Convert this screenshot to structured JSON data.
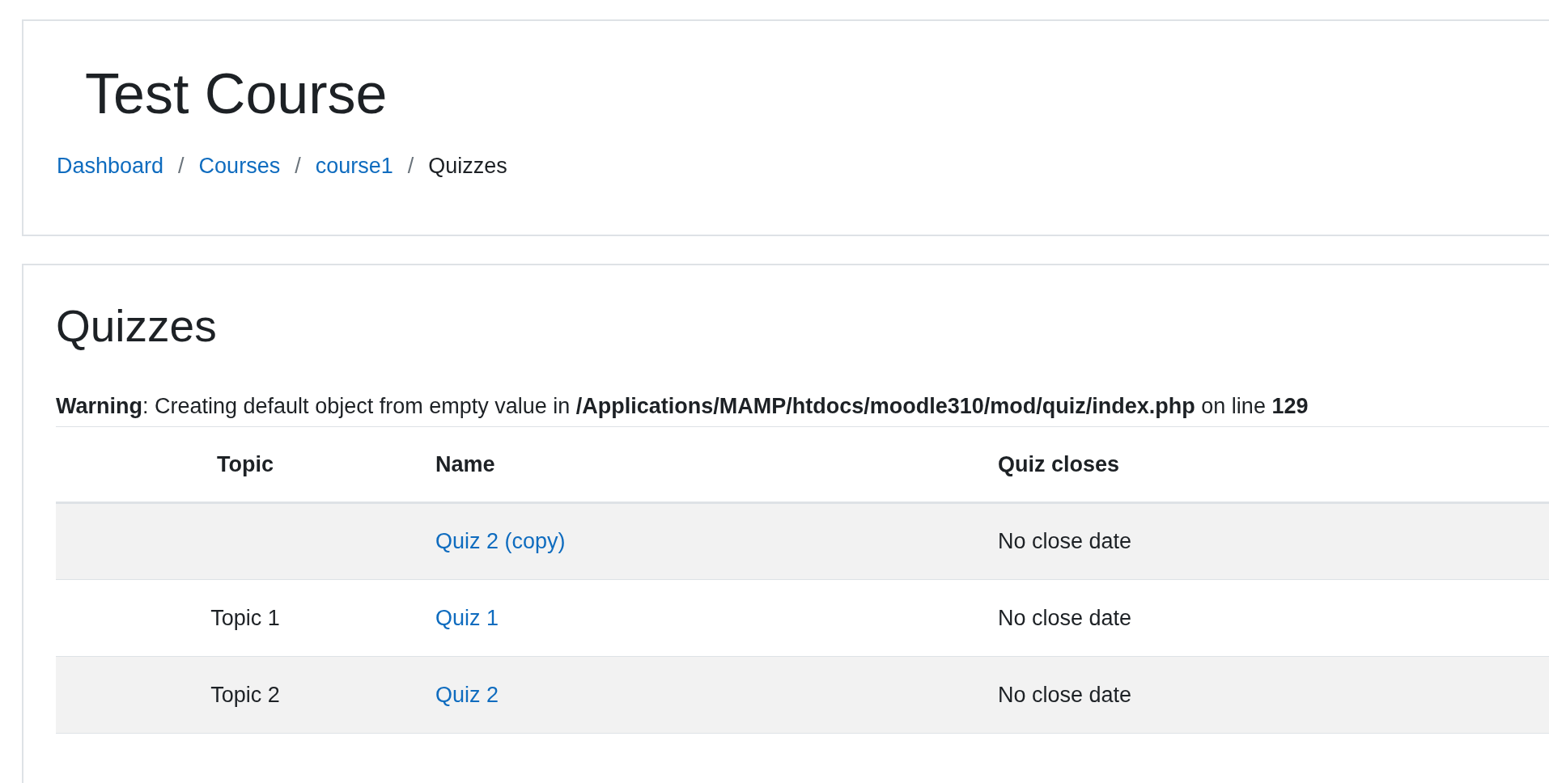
{
  "page_header": {
    "title": "Test Course",
    "separator": "/",
    "breadcrumb": [
      {
        "label": "Dashboard",
        "kind": "link"
      },
      {
        "label": "Courses",
        "kind": "link"
      },
      {
        "label": "course1",
        "kind": "link"
      },
      {
        "label": "Quizzes",
        "kind": "current"
      }
    ]
  },
  "main": {
    "heading": "Quizzes",
    "warning": "**Warning**: Creating default object from empty value in **/Applications/MAMP/htdocs/moodle310/mod/quiz/index.php** on line **129**",
    "table": {
      "columns": [
        "Topic",
        "Name",
        "Quiz closes"
      ],
      "rows": [
        {
          "name": "Quiz 2 (copy)",
          "closes": "No close date"
        },
        {
          "topic": "Topic 1",
          "name": "Quiz 1",
          "closes": "No close date"
        },
        {
          "topic": "Topic 2",
          "name": "Quiz 2",
          "closes": "No close date"
        }
      ]
    }
  }
}
